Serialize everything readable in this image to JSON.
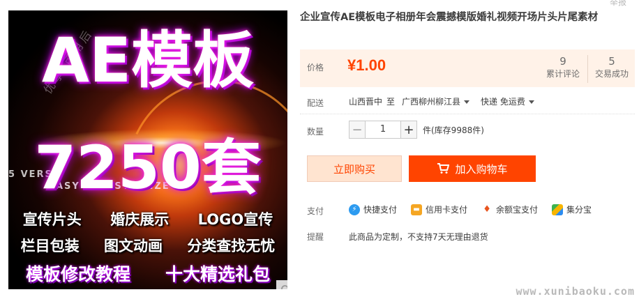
{
  "report_link": "举报",
  "image": {
    "title_line1": "AE模板",
    "title_line2": "7250套",
    "small_text1": "5 VERSI",
    "small_text2": "ASY TO   USTOMIZE",
    "row1": [
      "宣传片头",
      "婚庆展示",
      "LOGO宣传"
    ],
    "row2": [
      "栏目包装",
      "图文动画",
      "分类查找无忧"
    ],
    "row3": [
      "模板修改教程",
      "十大精选礼包"
    ],
    "wm": "优享·可用后"
  },
  "product": {
    "title": "企业宣传AE模板电子相册年会震撼模版婚礼视频开场片头片尾素材"
  },
  "price": {
    "label": "价格",
    "value": "¥1.00",
    "reviews_count": "9",
    "reviews_label": "累计评论",
    "sales_count": "5",
    "sales_label": "交易成功"
  },
  "shipping": {
    "label": "配送",
    "from": "山西晋中",
    "to_word": "至",
    "to": "广西柳州柳江县",
    "method": "快递 免运费"
  },
  "quantity": {
    "label": "数量",
    "value": "1",
    "minus": "−",
    "plus": "+",
    "stock": "件(库存9988件)"
  },
  "actions": {
    "buy_now": "立即购买",
    "add_to_cart": "加入购物车"
  },
  "payment": {
    "label": "支付",
    "methods": [
      "快捷支付",
      "信用卡支付",
      "余额宝支付",
      "集分宝"
    ]
  },
  "reminder": {
    "label": "提醒",
    "text": "此商品为定制，不支持7天无理由退货"
  },
  "site_watermark": "www.xunibaoku.com",
  "colors": {
    "accent": "#ff4400",
    "price_bg": "#fff2e8"
  }
}
